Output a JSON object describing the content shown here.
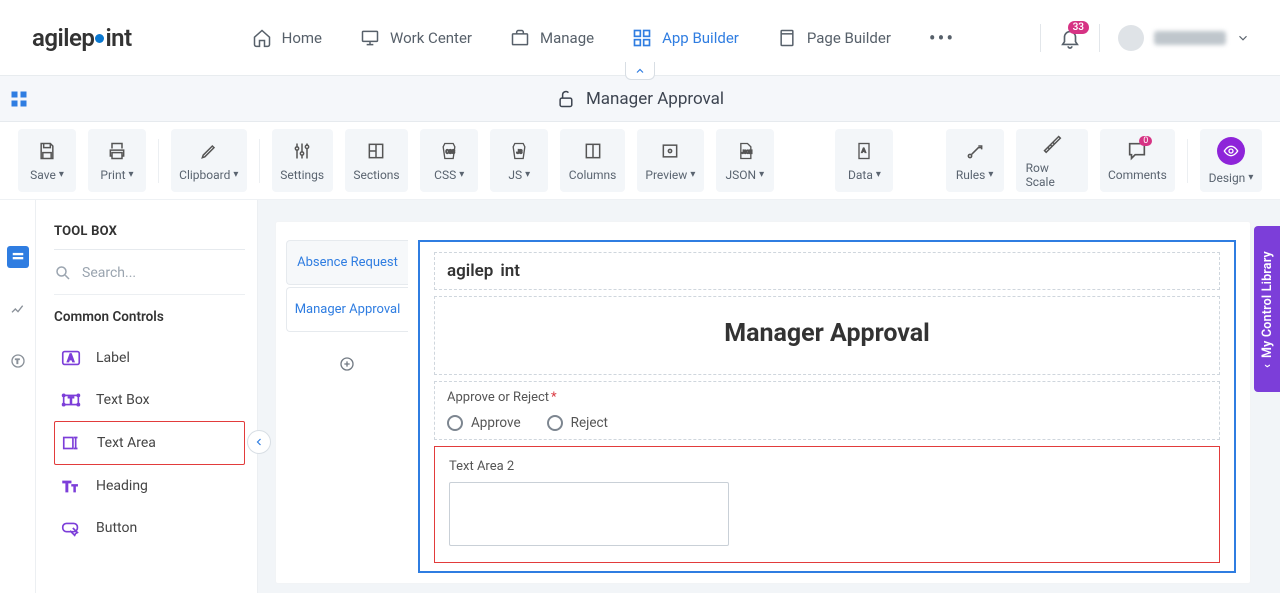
{
  "brand": "agilepoint",
  "nav": {
    "items": [
      {
        "label": "Home"
      },
      {
        "label": "Work Center"
      },
      {
        "label": "Manage"
      },
      {
        "label": "App Builder"
      },
      {
        "label": "Page Builder"
      }
    ],
    "active_index": 3,
    "notifications": "33"
  },
  "subbar": {
    "title": "Manager Approval"
  },
  "toolbar": {
    "save": "Save",
    "print": "Print",
    "clipboard": "Clipboard",
    "settings": "Settings",
    "sections": "Sections",
    "css": "CSS",
    "js": "JS",
    "columns": "Columns",
    "preview": "Preview",
    "json": "JSON",
    "data": "Data",
    "rules": "Rules",
    "rowscale": "Row Scale",
    "comments": "Comments",
    "comments_count": "0",
    "design": "Design"
  },
  "toolbox": {
    "title": "TOOL BOX",
    "search_placeholder": "Search...",
    "group": "Common Controls",
    "items": [
      {
        "label": "Label"
      },
      {
        "label": "Text Box"
      },
      {
        "label": "Text Area"
      },
      {
        "label": "Heading"
      },
      {
        "label": "Button"
      }
    ],
    "highlight_index": 2
  },
  "tabs": {
    "items": [
      {
        "label": "Absence Request"
      },
      {
        "label": "Manager Approval"
      }
    ],
    "active_index": 1
  },
  "form": {
    "header_brand": "agilepoint",
    "title": "Manager Approval",
    "approve_label": "Approve or Reject",
    "option_approve": "Approve",
    "option_reject": "Reject",
    "ta_label": "Text Area 2"
  },
  "rightpanel": {
    "label": "My Control Library"
  }
}
